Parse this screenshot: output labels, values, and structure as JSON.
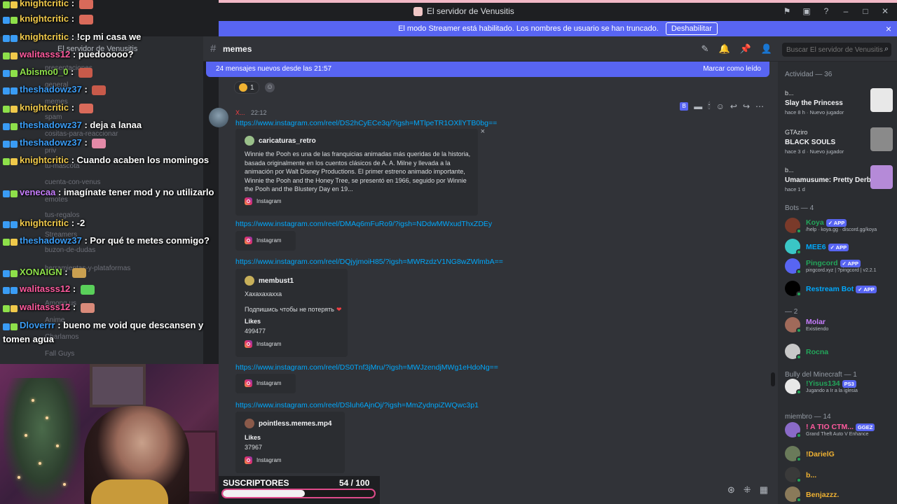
{
  "window": {
    "title": "El servidor de Venusitis"
  },
  "banner": {
    "text": "El modo Streamer está habilitado. Los nombres de usuario se han truncado.",
    "button": "Deshabilitar",
    "close": "×"
  },
  "server_sidebar": {
    "name": "El servidor de Venusitis",
    "channels": [
      "presentaciones",
      "general",
      "memes",
      "spam",
      "cositas-para-reaccionar",
      "priv",
      "tu-mascota",
      "cuenta-con-venus",
      "emotes",
      "tus-regalos",
      "Streamers",
      "buzon-de-dudas",
      "herramientas-y-plataformas",
      "Among us",
      "Anime",
      "Charlamos",
      "Fall Guys"
    ]
  },
  "overlay_chat": [
    {
      "user": "knightcritic",
      "color": "#f0c94a",
      "text": "",
      "emote_color": "#d96a5a"
    },
    {
      "user": "knightcritic",
      "color": "#f0c94a",
      "text": "",
      "emote_color": "#d96a5a"
    },
    {
      "user": "knightcritic",
      "color": "#f0c94a",
      "text": "!cp mi casa we",
      "emote_color": ""
    },
    {
      "user": "walitasss12",
      "color": "#ff5a9e",
      "text": "puedooooo?",
      "emote_color": ""
    },
    {
      "user": "Abismo0_0",
      "color": "#8ee04a",
      "text": "",
      "emote_color": "#c85a4a"
    },
    {
      "user": "theshadowz37",
      "color": "#3a9cf5",
      "text": "",
      "emote_color": "#c85a4a"
    },
    {
      "user": "knightcritic",
      "color": "#f0c94a",
      "text": "",
      "emote_color": "#d96a5a"
    },
    {
      "user": "theshadowz37",
      "color": "#3a9cf5",
      "text": "deja a lanaa",
      "emote_color": ""
    },
    {
      "user": "theshadowz37",
      "color": "#3a9cf5",
      "text": "",
      "emote_color": "#e48aa8"
    },
    {
      "user": "knightcritic",
      "color": "#f0c94a",
      "text": "Cuando acaben los momingos",
      "emote_color": ""
    },
    {
      "user": "venecaa",
      "color": "#c77dff",
      "text": "imagínate tener mod y no utilizarlo",
      "emote_color": ""
    },
    {
      "user": "knightcritic",
      "color": "#f0c94a",
      "text": "-2",
      "emote_color": ""
    },
    {
      "user": "theshadowz37",
      "color": "#3a9cf5",
      "text": "Por qué te metes conmigo?",
      "emote_color": ""
    },
    {
      "user": "XONAIGN",
      "color": "#8ee04a",
      "text": "",
      "emote_color": "#caa050"
    },
    {
      "user": "walitasss12",
      "color": "#ff5a9e",
      "text": "",
      "emote_color": "#5ad05a"
    },
    {
      "user": "walitasss12",
      "color": "#ff5a9e",
      "text": "",
      "emote_color": "#d98a7a"
    },
    {
      "user": "Dloverrr",
      "color": "#3a9cf5",
      "text": "bueno me void que descansen y",
      "emote_color": ""
    },
    {
      "user": "",
      "color": "#ffffff",
      "text": "tomen agua",
      "emote_color": ""
    }
  ],
  "subscribers": {
    "label": "SUSCRIPTORES",
    "count_text": "54  / 100",
    "current": 54,
    "goal": 100
  },
  "channel": {
    "name": "memes",
    "search_placeholder": "Buscar El servidor de Venusitis"
  },
  "new_messages": {
    "text": "24 mensajes nuevos desde las 21:57",
    "action": "Marcar como leído"
  },
  "reaction": {
    "count": "1"
  },
  "message": {
    "author": "X...",
    "time": "22:12",
    "posts": [
      {
        "url": "https://www.instagram.com/reel/DS2hCyECe3q/?igsh=MTlpeTR1OXllYTB0bg==",
        "embed": {
          "author": "caricaturas_retro",
          "description": "Winnie the Pooh es una de las franquicias animadas más queridas de la historia, basada originalmente en los cuentos clásicos de A. A. Milne y llevada a la animación por Walt Disney Productions. El primer estreno animado importante, Winnie the Pooh and the Honey Tree, se presentó en 1966, seguido por Winnie the Pooh and the Blustery Day en 19...",
          "footer": "Instagram"
        }
      },
      {
        "url": "https://www.instagram.com/reel/DMAq6mFuRo9/?igsh=NDdwMWxudThxZDEy",
        "embed": {
          "footer": "Instagram"
        }
      },
      {
        "url": "https://www.instagram.com/reel/DQjyjmoiH85/?igsh=MWRzdzV1NG8wZWlmbA==",
        "embed": {
          "author": "membust1",
          "line1": "Хахахахахха",
          "line2": "Подпишись чтобы не потерять",
          "heart": "❤",
          "likes_label": "Likes",
          "likes_value": "499477",
          "footer": "Instagram"
        }
      },
      {
        "url": "https://www.instagram.com/reel/DS0Tnf3jMru/?igsh=MWJzendjMWg1eHdoNg==",
        "embed": {
          "footer": "Instagram"
        }
      },
      {
        "url": "https://www.instagram.com/reel/DSluh6AjnOj/?igsh=MmZydnpiZWQwc3p1",
        "embed": {
          "author": "pointless.memes.mp4",
          "likes_label": "Likes",
          "likes_value": "37967",
          "footer": "Instagram"
        }
      }
    ]
  },
  "members": {
    "activity_header": "Actividad — 36",
    "activities": [
      {
        "who": "b...",
        "game": "Slay the Princess",
        "sub": "hace 8 h · Nuevo jugador",
        "art_color": "#e8e8e8"
      },
      {
        "who": "GTAziro",
        "game": "BLACK SOULS",
        "sub": "hace 3 d · Nuevo jugador",
        "art_color": "#8a8a8a"
      },
      {
        "who": "b...",
        "game": "Umamusume: Pretty Derby",
        "sub": "hace 1 d",
        "art_color": "#b58ad8"
      }
    ],
    "groups": [
      {
        "header": "Bots — 4",
        "items": [
          {
            "name": "Koya",
            "tag": "✓ APP",
            "status": "/help · koya.gg · discord.gg/koya",
            "color": "#23a55a",
            "avatar": "#7a3a2a"
          },
          {
            "name": "MEE6",
            "tag": "✓ APP",
            "status": "",
            "color": "#00a8fc",
            "avatar": "#3ac6c6"
          },
          {
            "name": "Pingcord",
            "tag": "✓ APP",
            "status": "pingcord.xyz | ?pingcord | v2.2.1",
            "color": "#23a55a",
            "avatar": "#5865f2"
          },
          {
            "name": "Restream Bot",
            "tag": "✓ APP",
            "status": "",
            "color": "#00a8fc",
            "avatar": "#000000"
          }
        ]
      },
      {
        "header": "— 2",
        "items": [
          {
            "name": "Molar",
            "tag": "",
            "status": "Existiendo",
            "color": "#c77dff",
            "avatar": "#a06a5a"
          },
          {
            "name": "Rocna",
            "tag": "",
            "status": "",
            "color": "#23a55a",
            "avatar": "#c8c8c8"
          }
        ]
      },
      {
        "header": "Bully del Minecraft — 1",
        "items": [
          {
            "name": "!Yisus134",
            "tag": "PS3",
            "status": "Jugando a Ir a la iglesia",
            "color": "#23a55a",
            "avatar": "#e8e8e8"
          }
        ]
      },
      {
        "header": "miembro — 14",
        "items": [
          {
            "name": "! A TIO CTM...",
            "tag": "GGEZ",
            "status": "Grand Theft Auto V Enhance",
            "color": "#ff5a9e",
            "avatar": "#8a6ac8"
          },
          {
            "name": "!DarielG",
            "tag": "",
            "status": "",
            "color": "#f0b232",
            "avatar": "#6a7a5a"
          },
          {
            "name": "b...",
            "tag": "",
            "status": "",
            "color": "#f0b232",
            "avatar": "#3a3a3a"
          },
          {
            "name": "Benjazzz.",
            "tag": "",
            "status": "",
            "color": "#f0b232",
            "avatar": "#8a7a5a"
          }
        ]
      }
    ]
  },
  "colors": {
    "blurple": "#5865f2",
    "link": "#00a8fc",
    "bg_main": "#313338",
    "bg_side": "#2b2d31",
    "subs_border": "#e04b8a"
  }
}
